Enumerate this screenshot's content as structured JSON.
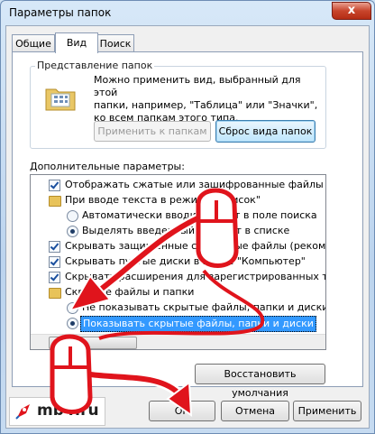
{
  "window": {
    "title": "Параметры папок",
    "close_label": "x"
  },
  "tabs": [
    "Общие",
    "Вид",
    "Поиск"
  ],
  "folder_view": {
    "title": "Представление папок",
    "description_lines": [
      "Можно применить вид, выбранный для этой",
      "папки, например, \"Таблица\" или \"Значки\",",
      "ко всем папкам этого типа."
    ],
    "apply_button": "Применить к папкам",
    "reset_button": "Сброс вида папок"
  },
  "advanced": {
    "title": "Дополнительные параметры:",
    "items": [
      "Отображать сжатые или зашифрованные файлы NTI",
      "При вводе текста в режиме \"Список\"",
      "Автоматически вводить текст в поле поиска",
      "Выделять введенный элемент в списке",
      "Скрывать защищенные системные файлы (рекомен",
      "Скрывать пустые диски в папке \"Компьютер\"",
      "Скрывать расширения для зарегистрированных типо",
      "Скрытые файлы и папки",
      "Не показывать скрытые файлы, папки и диски",
      "Показывать скрытые файлы, папки и диски"
    ]
  },
  "restore_button": "Восстановить умолчания",
  "footer": {
    "logo_text": "mb4.ru",
    "ok": "ОК",
    "cancel": "Отмена",
    "apply": "Применить"
  },
  "colors": {
    "accent_red": "#e0141c",
    "selection": "#3399ff"
  }
}
